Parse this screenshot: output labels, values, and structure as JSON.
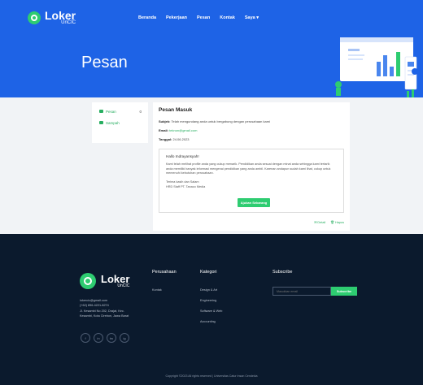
{
  "header": {
    "brand_name": "Loker",
    "brand_sub": "UnCIC",
    "nav": [
      "Beranda",
      "Pekerjaan",
      "Pesan",
      "Kontak",
      "Saya ▾"
    ],
    "page_title": "Pesan"
  },
  "sidebar": {
    "items": [
      {
        "label": "Pesan",
        "count": "0",
        "icon": "inbox-icon"
      },
      {
        "label": "Sampah",
        "icon": "trash-icon"
      }
    ]
  },
  "message": {
    "heading": "Pesan Masuk",
    "subject_label": "Subjek:",
    "subject": "Telah mengundang anda untuk bergabung dengan perusahaan kami",
    "email_label": "Email:",
    "email": "teknon@gmail.com",
    "date_label": "Tanggal:",
    "date": "24.06.2023",
    "greeting": "Hallo Indrayansyah!",
    "body": "Kami telah melihat profile anda yang cukup menarik. Pendidikan anda sesuai dengan minat anda sehingga kami tertarik anda memiliki banyak informasi mengenai pendidikan yang anda ambil. Karenan andapun sudah kami lihat, cukup untuk memenuhi kebutuhan perusahaan.",
    "signoff": "Terima kasih dan Salam",
    "signer": "HRD Staff PT. Tanaco Media",
    "button": "Ajukan Sekarang",
    "actions": [
      "✉ Detail",
      "🗑 Hapus"
    ]
  },
  "footer": {
    "brand_name": "Loker",
    "brand_sub": "UnCIC",
    "info": [
      "lokercic@gmail.com",
      "(+62) 896-4221-8274",
      "Jl. Kesambi No 202, Drajat, Kec.",
      "Kesambi, Kota Cirebon, Jawa Barat"
    ],
    "socials": [
      "f",
      "in",
      "tw",
      "ig"
    ],
    "col1_title": "Perusahaan",
    "col1_items": [
      "Kontak"
    ],
    "col2_title": "Kategori",
    "col2_items": [
      "Design & Art",
      "Engineering",
      "Software & Web",
      "Accounting"
    ],
    "subscribe_title": "Subscribe",
    "subscribe_placeholder": "Masukkan email",
    "subscribe_button": "Subscribe",
    "copyright": "Copyright ©2023 All rights reserved | Universitas Catur Insan Cendekia"
  },
  "colors": {
    "primary": "#1e63e6",
    "accent": "#2ecc71",
    "footer": "#0b1a2d"
  }
}
